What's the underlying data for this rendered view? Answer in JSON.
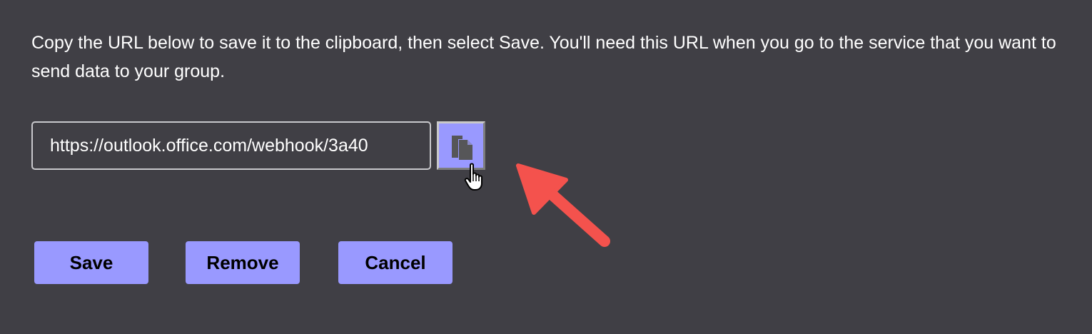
{
  "dialog": {
    "instructions": "Copy the URL below to save it to the clipboard, then select Save. You'll need this URL when you go to the service that you want to send data to your group.",
    "url_value": "https://outlook.office.com/webhook/3a40",
    "copy_icon": "copy-icon"
  },
  "buttons": {
    "save": "Save",
    "remove": "Remove",
    "cancel": "Cancel"
  },
  "colors": {
    "background": "#403f45",
    "button": "#9999ff",
    "annotation_arrow": "#f4524d",
    "text": "#ffffff"
  }
}
